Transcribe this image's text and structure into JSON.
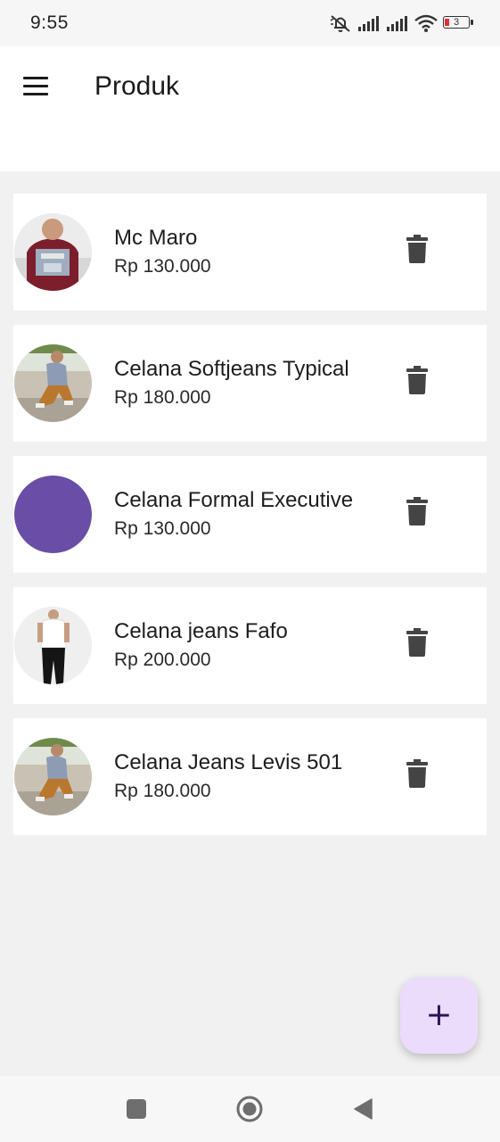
{
  "status_bar": {
    "time": "9:55",
    "battery": "3",
    "icons": [
      "mute-icon",
      "signal-icon",
      "signal-icon",
      "wifi-icon",
      "battery-icon"
    ]
  },
  "app_bar": {
    "menu_icon": "hamburger-menu-icon",
    "title": "Produk"
  },
  "products": [
    {
      "name": "Mc Maro",
      "price": "Rp 130.000",
      "image": "maroon-sweater-photo"
    },
    {
      "name": "Celana Softjeans Typical",
      "price": "Rp 180.000",
      "image": "man-sitting-photo"
    },
    {
      "name": "Celana Formal Executive",
      "price": "Rp 130.000",
      "image": "purple-placeholder"
    },
    {
      "name": "Celana jeans Fafo",
      "price": "Rp 200.000",
      "image": "white-shirt-black-pants-photo"
    },
    {
      "name": "Celana Jeans Levis 501",
      "price": "Rp 180.000",
      "image": "man-sitting-photo"
    }
  ],
  "delete_icon": "trash-icon",
  "fab": {
    "icon": "plus-icon",
    "symbol": "+"
  },
  "nav_bar": {
    "icons": [
      "recent-apps-icon",
      "home-icon",
      "back-icon"
    ]
  },
  "colors": {
    "background": "#f1f1f1",
    "card": "#ffffff",
    "fab": "#ebdcfb",
    "fab_icon": "#2d1457",
    "placeholder_avatar": "#6a4da6",
    "trash": "#444444"
  }
}
